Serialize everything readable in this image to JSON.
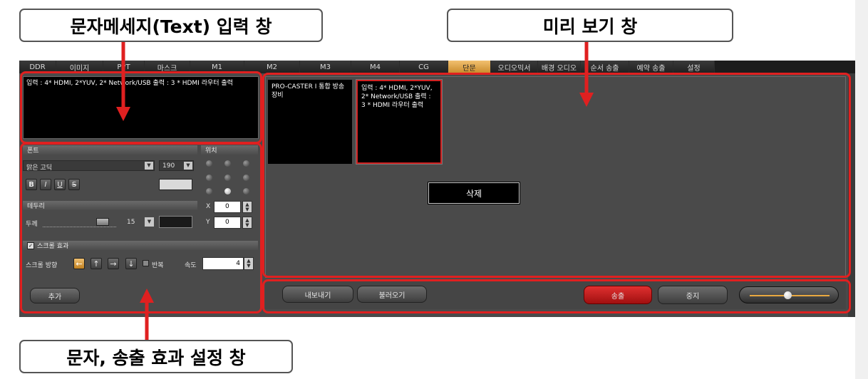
{
  "callouts": {
    "text_input": "문자메세지(Text) 입력 창",
    "preview": "미리 보기 창",
    "effects": "문자, 송출 효과 설정 창"
  },
  "tabs": [
    "DDR",
    "이미지",
    "PPT",
    "마스크",
    "M1",
    "M2",
    "M3",
    "M4",
    "CG",
    "단문",
    "오디오믹서",
    "배경 오디오",
    "순서 송출",
    "예약 송출",
    "설정"
  ],
  "active_tab": "단문",
  "input_text": "입력 : 4* HDMI, 2*YUV, 2* Network/USB    출력 : 3 * HDMI 라우터 출력",
  "font": {
    "header": "폰트",
    "family": "맑은 고딕",
    "size": "190",
    "bold": "B",
    "italic": "I",
    "underline": "U",
    "strike": "S"
  },
  "position": {
    "header": "위치",
    "x_label": "X",
    "x_value": "0",
    "y_label": "Y",
    "y_value": "0",
    "selected": "center-bottom"
  },
  "border": {
    "header": "테두리",
    "thickness_label": "두께",
    "thickness_value": "15"
  },
  "scroll": {
    "checkbox_label": "스크롤 효과",
    "direction_label": "스크롤 방향",
    "repeat_label": "반복",
    "speed_label": "속도",
    "speed_value": "4"
  },
  "add_button": "추가",
  "preview": {
    "card1": "PRO-CASTER I 통합 방송장비",
    "card2": "입력 : 4* HDMI, 2*YUV, 2* Network/USB   출력 : 3 * HDMI 라우터 출력",
    "delete_button": "삭제"
  },
  "bottom": {
    "export": "내보내기",
    "import": "불러오기",
    "broadcast": "송출",
    "stop": "중지"
  },
  "colors": {
    "accent_red": "#e02020",
    "tab_active": "#e0a040",
    "broadcast": "#c01818"
  }
}
